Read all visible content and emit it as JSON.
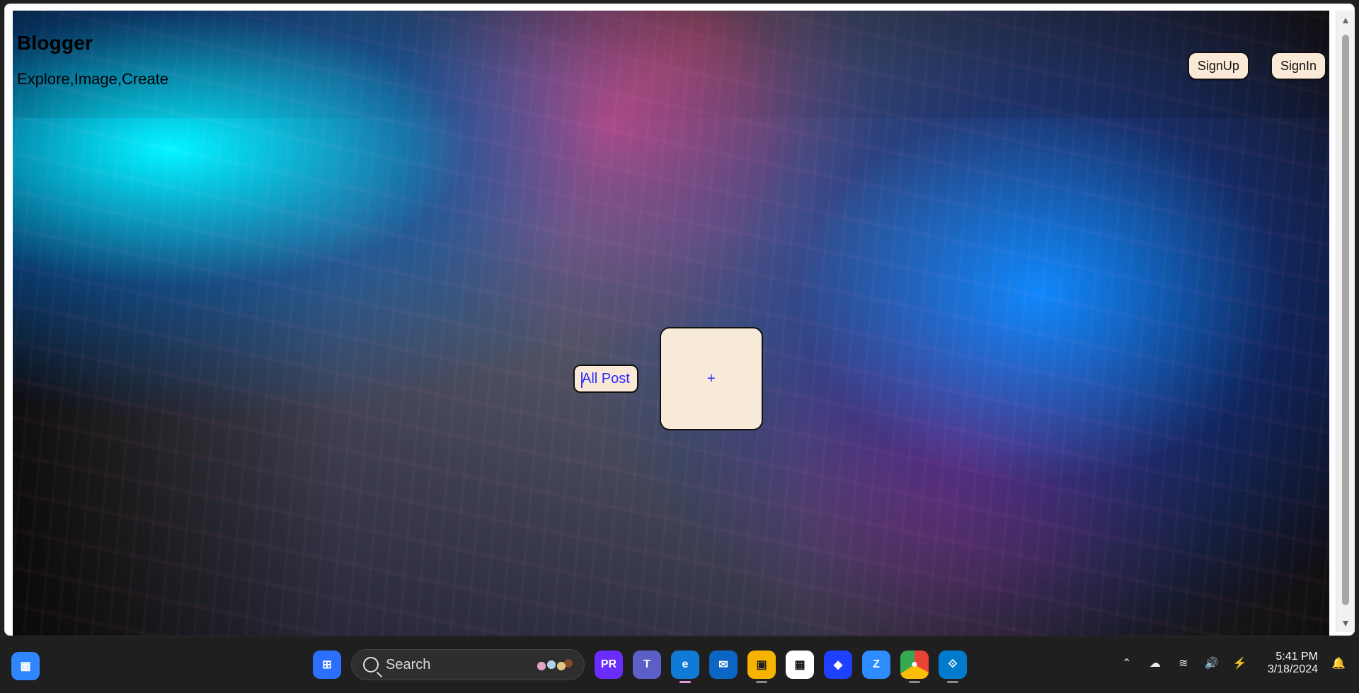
{
  "header": {
    "title": "Blogger",
    "tagline": "Explore,Image,Create"
  },
  "auth": {
    "signup_label": "SignUp",
    "signin_label": "SignIn"
  },
  "main": {
    "all_post_label": "All Post",
    "add_label": "+"
  },
  "taskbar": {
    "search_placeholder": "Search",
    "time": "5:41 PM",
    "date": "3/18/2024",
    "icons": [
      "widgets-icon",
      "windows-start-icon",
      "search-icon",
      "copilot-pre-icon",
      "teams-icon",
      "edge-icon",
      "mail-icon",
      "file-explorer-icon",
      "microsoft-store-icon",
      "app-icon",
      "zoom-icon",
      "chrome-icon",
      "vscode-icon"
    ],
    "tray_icons": [
      "chevron-up-icon",
      "onedrive-icon",
      "wifi-icon",
      "volume-icon",
      "battery-icon",
      "notification-icon"
    ]
  }
}
